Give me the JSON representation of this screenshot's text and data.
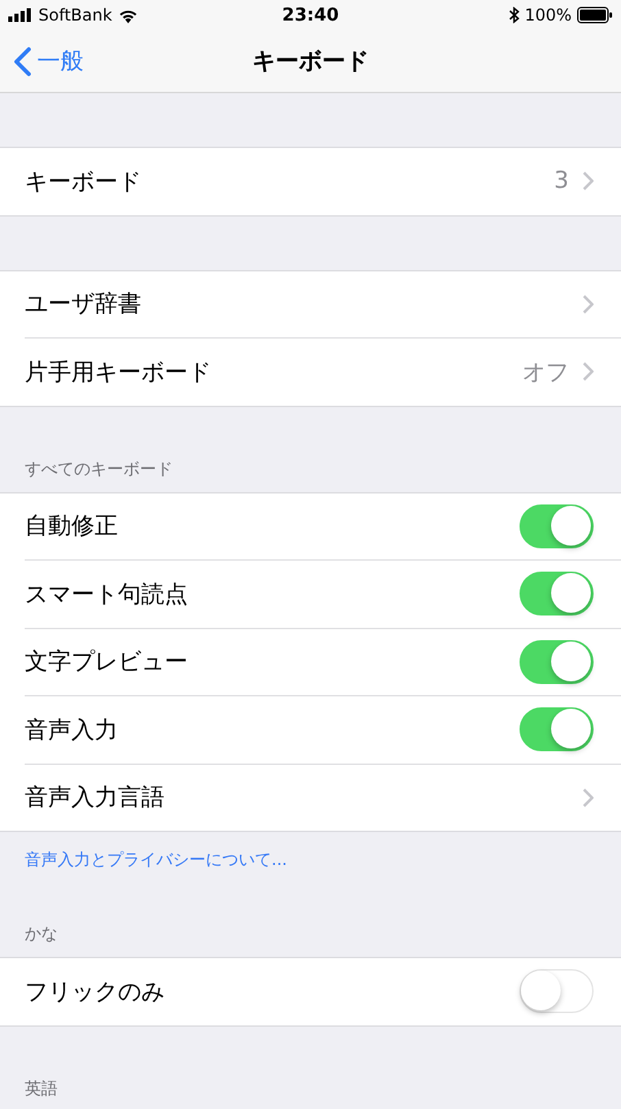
{
  "status_bar": {
    "carrier": "SoftBank",
    "time": "23:40",
    "battery": "100%"
  },
  "nav": {
    "back": "一般",
    "title": "キーボード"
  },
  "sections": [
    {
      "rows": [
        {
          "kind": "link",
          "label": "キーボード",
          "value": "3"
        }
      ]
    },
    {
      "rows": [
        {
          "kind": "link",
          "label": "ユーザ辞書"
        },
        {
          "kind": "link",
          "label": "片手用キーボード",
          "value": "オフ"
        }
      ]
    },
    {
      "header": "すべてのキーボード",
      "footer_link": "音声入力とプライバシーについて...",
      "rows": [
        {
          "kind": "toggle",
          "label": "自動修正",
          "on": true
        },
        {
          "kind": "toggle",
          "label": "スマート句読点",
          "on": true
        },
        {
          "kind": "toggle",
          "label": "文字プレビュー",
          "on": true
        },
        {
          "kind": "toggle",
          "label": "音声入力",
          "on": true
        },
        {
          "kind": "link",
          "label": "音声入力言語"
        }
      ]
    },
    {
      "header": "かな",
      "rows": [
        {
          "kind": "toggle",
          "label": "フリックのみ",
          "on": false
        }
      ]
    },
    {
      "header": "英語"
    }
  ]
}
